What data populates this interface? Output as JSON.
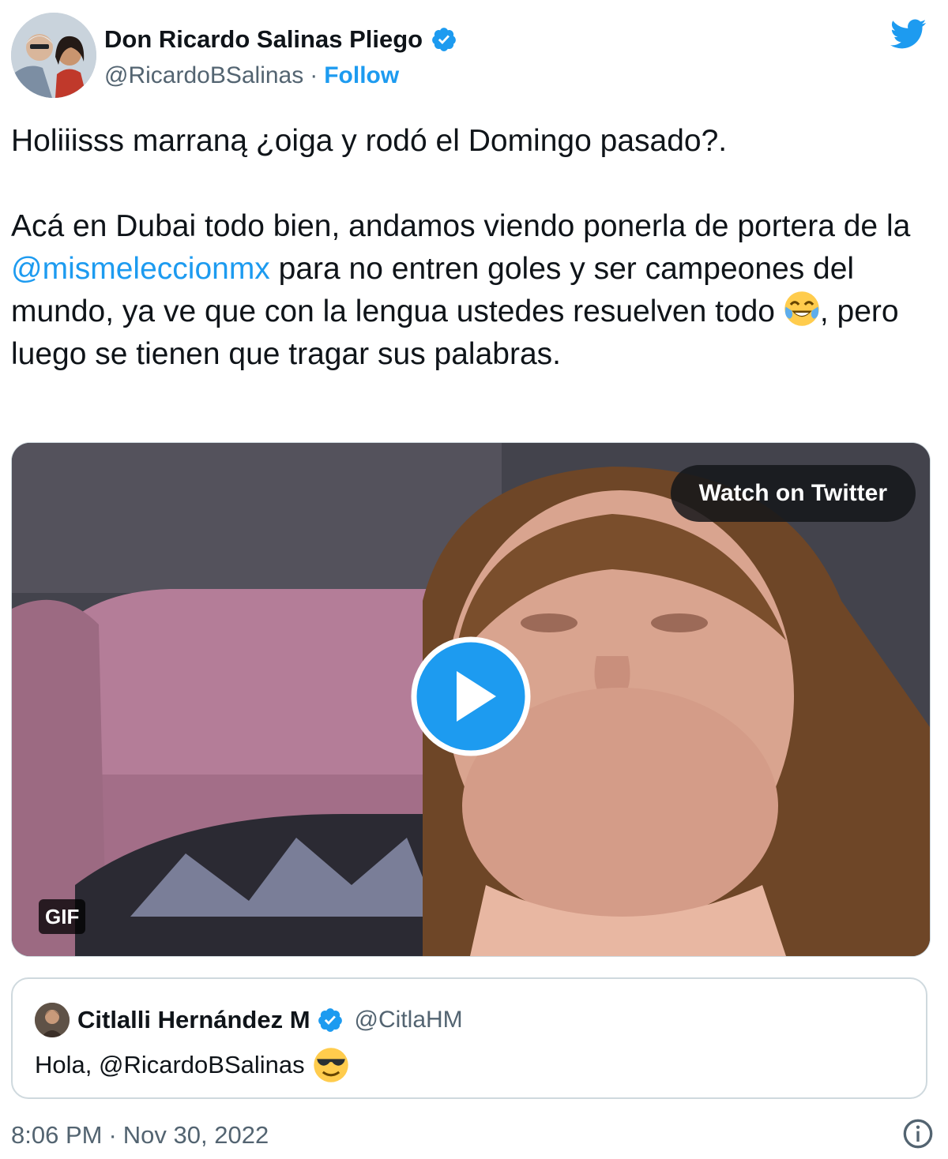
{
  "author": {
    "display_name": "Don Ricardo Salinas Pliego",
    "handle": "@RicardoBSalinas",
    "separator": "·",
    "follow_label": "Follow"
  },
  "tweet": {
    "line1": "Holiiisss marraną ¿oiga y rodó el Domingo pasado?.",
    "para2_before": "Acá en Dubai todo bien, andamos viendo ponerla de portera de la ",
    "mention": "@mismeleccionmx",
    "para2_after": " para no entren goles  y ser campeones del mundo, ya ve que con la lengua ustedes resuelven todo ",
    "para2_end": ", pero luego se tienen que tragar sus palabras.",
    "emoji_name": "face-with-tears-of-joy"
  },
  "media": {
    "watch_label": "Watch on Twitter",
    "gif_badge": "GIF"
  },
  "quote": {
    "display_name": "Citlalli Hernández M",
    "handle": "@CitlaHM",
    "text": "Hola, @RicardoBSalinas",
    "emoji_name": "smiling-face-with-sunglasses"
  },
  "footer": {
    "time": "8:06 PM",
    "separator": "·",
    "date": "Nov 30, 2022"
  },
  "colors": {
    "accent": "#1d9bf0",
    "text": "#0f1419",
    "secondary": "#536471",
    "border": "#cfd9de"
  }
}
